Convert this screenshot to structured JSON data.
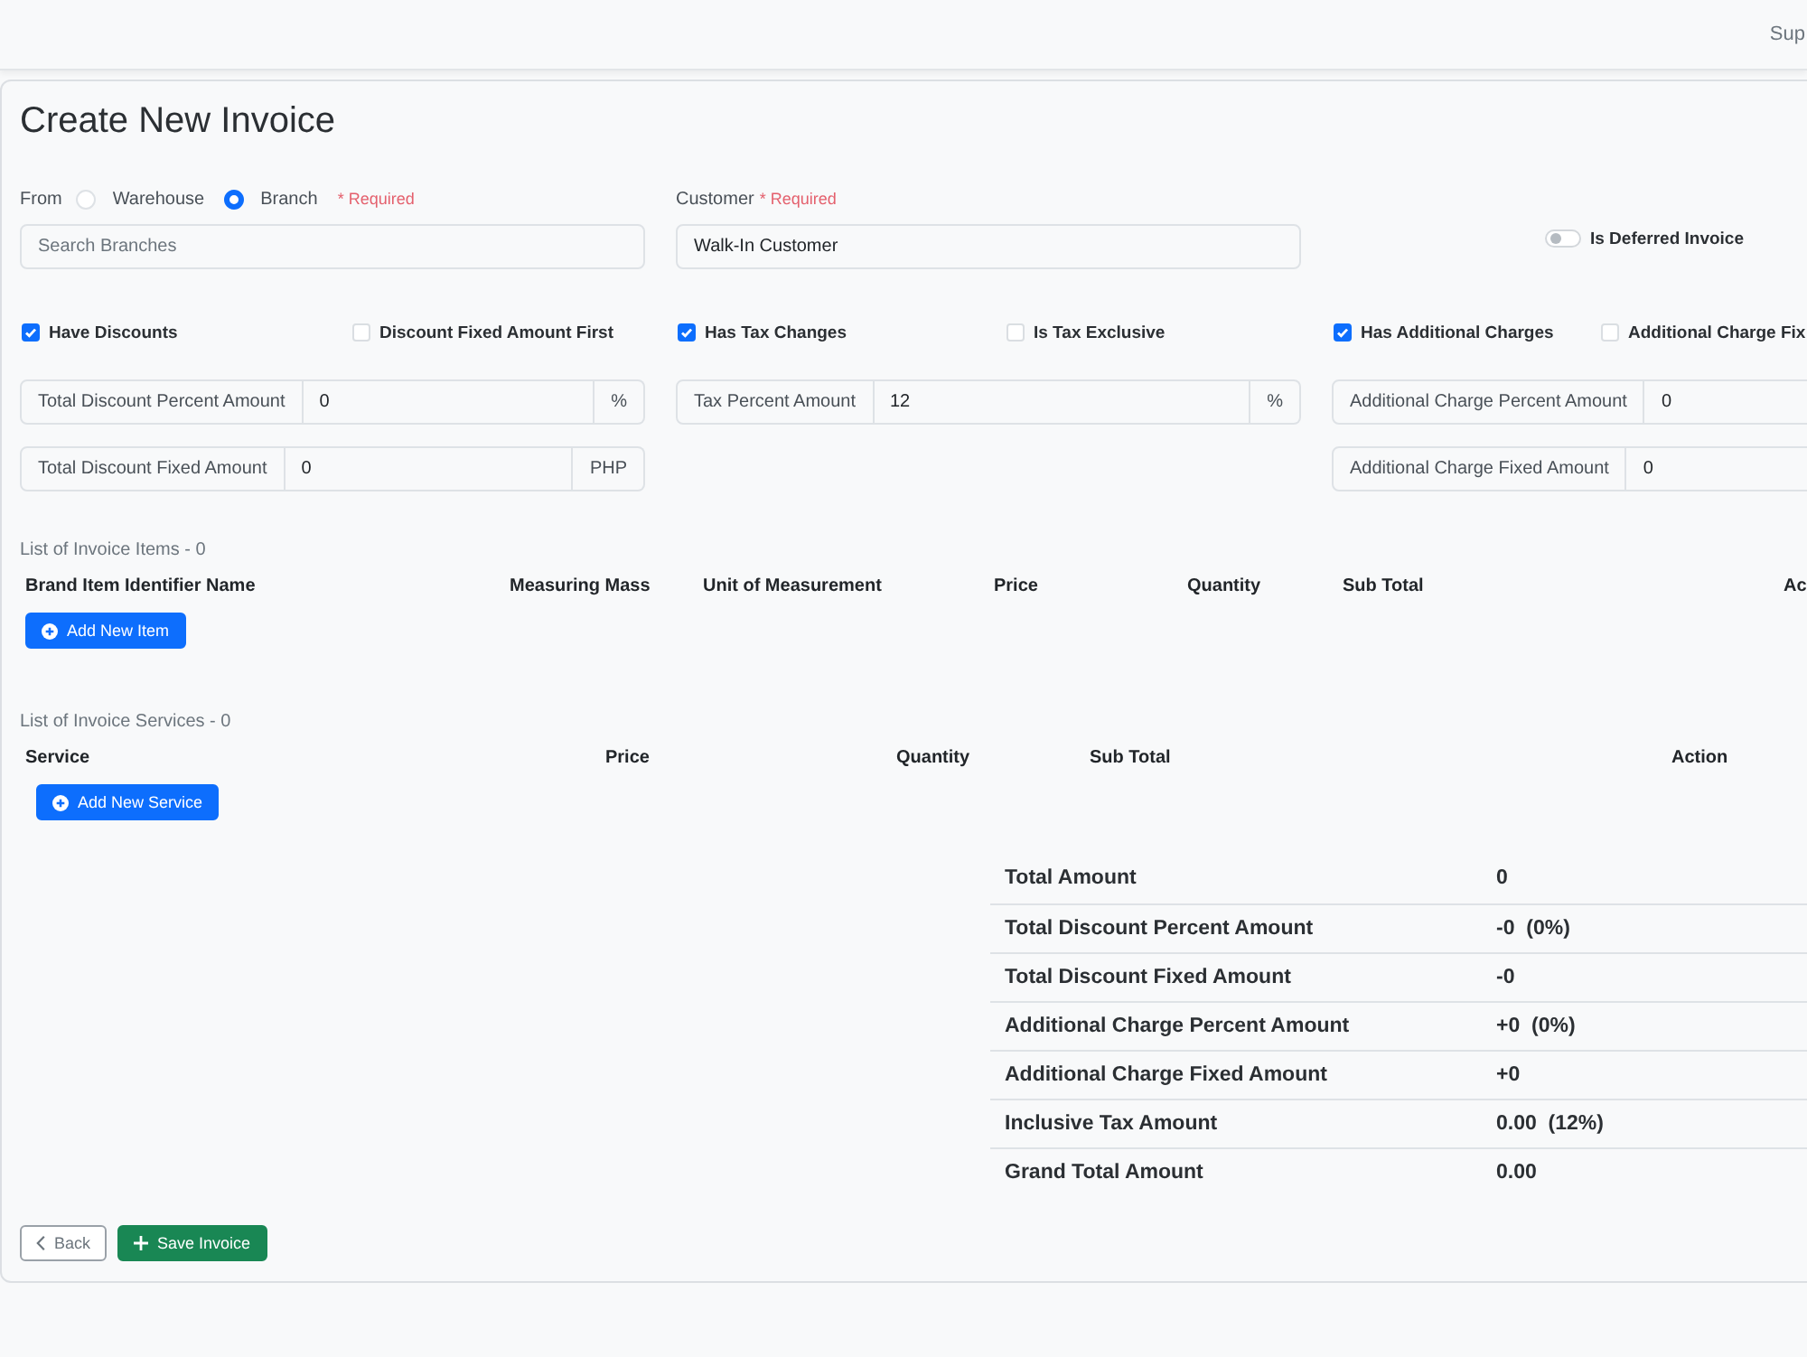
{
  "top_nav": {
    "user_menu": "Sup"
  },
  "page": {
    "title": "Create New Invoice"
  },
  "source": {
    "label": "From",
    "options": [
      {
        "label": "Warehouse",
        "selected": false
      },
      {
        "label": "Branch",
        "selected": true
      }
    ],
    "required": "* Required",
    "search": {
      "placeholder": "Search Branches"
    }
  },
  "customer": {
    "label": "Customer",
    "required": "* Required",
    "value": "Walk-In Customer"
  },
  "deferred": {
    "label": "Is Deferred Invoice",
    "on": false
  },
  "adjustments": [
    {
      "toggles": [
        {
          "label": "Have Discounts",
          "checked": true
        },
        {
          "label": "Discount Fixed Amount First",
          "checked": false
        }
      ],
      "fields": [
        {
          "label": "Total Discount Percent Amount",
          "value": "0",
          "unit": "%"
        },
        {
          "label": "Total Discount Fixed Amount",
          "value": "0",
          "unit": "PHP"
        }
      ]
    },
    {
      "toggles": [
        {
          "label": "Has Tax Changes",
          "checked": true
        },
        {
          "label": "Is Tax Exclusive",
          "checked": false
        }
      ],
      "fields": [
        {
          "label": "Tax Percent Amount",
          "value": "12",
          "unit": "%"
        }
      ]
    },
    {
      "toggles": [
        {
          "label": "Has Additional Charges",
          "checked": true
        },
        {
          "label": "Additional Charge Fix",
          "checked": false
        }
      ],
      "fields": [
        {
          "label": "Additional Charge Percent Amount",
          "value": "0"
        },
        {
          "label": "Additional Charge Fixed Amount",
          "value": "0"
        }
      ]
    }
  ],
  "items": {
    "title": "List of Invoice Items - 0",
    "columns": [
      "Brand Item Identifier Name",
      "Measuring Mass",
      "Unit of Measurement",
      "Price",
      "Quantity",
      "Sub Total",
      "Ac"
    ],
    "add_button": "Add New Item"
  },
  "services": {
    "title": "List of Invoice Services - 0",
    "columns": [
      "Service",
      "Price",
      "Quantity",
      "Sub Total",
      "Action"
    ],
    "add_button": "Add New Service"
  },
  "totals": [
    {
      "label": "Total Amount",
      "value": "0"
    },
    {
      "label": "Total Discount Percent Amount",
      "value": "-0  (0%)"
    },
    {
      "label": "Total Discount Fixed Amount",
      "value": "-0"
    },
    {
      "label": "Additional Charge Percent Amount",
      "value": "+0  (0%)"
    },
    {
      "label": "Additional Charge Fixed Amount",
      "value": "+0"
    },
    {
      "label": "Inclusive Tax Amount",
      "value": "0.00  (12%)"
    },
    {
      "label": "Grand Total Amount",
      "value": "0.00"
    }
  ],
  "footer": {
    "buttons": [
      {
        "label": "Back",
        "kind": "back"
      },
      {
        "label": "Save Invoice",
        "kind": "save"
      }
    ]
  }
}
